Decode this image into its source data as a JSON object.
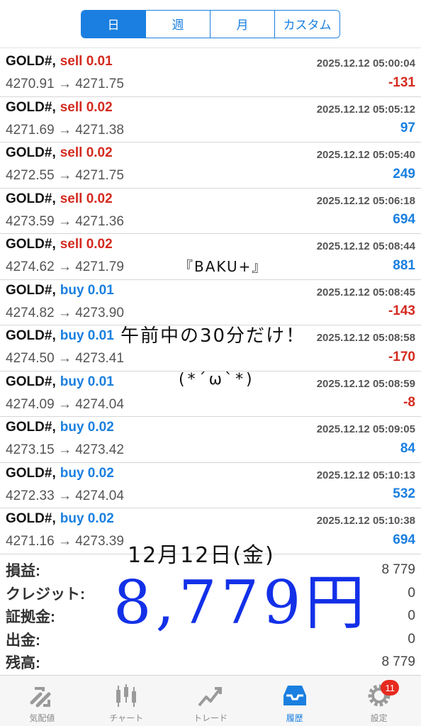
{
  "segments": [
    "日",
    "週",
    "月",
    "カスタム"
  ],
  "trades": [
    {
      "symbol": "GOLD#,",
      "side": "sell",
      "volume": "sell 0.01",
      "time": "2025.12.12 05:00:04",
      "prices": "4270.91 → 4271.75",
      "profit": "-131"
    },
    {
      "symbol": "GOLD#,",
      "side": "sell",
      "volume": "sell 0.02",
      "time": "2025.12.12 05:05:12",
      "prices": "4271.69 → 4271.38",
      "profit": "97"
    },
    {
      "symbol": "GOLD#,",
      "side": "sell",
      "volume": "sell 0.02",
      "time": "2025.12.12 05:05:40",
      "prices": "4272.55 → 4271.75",
      "profit": "249"
    },
    {
      "symbol": "GOLD#,",
      "side": "sell",
      "volume": "sell 0.02",
      "time": "2025.12.12 05:06:18",
      "prices": "4273.59 → 4271.36",
      "profit": "694"
    },
    {
      "symbol": "GOLD#,",
      "side": "sell",
      "volume": "sell 0.02",
      "time": "2025.12.12 05:08:44",
      "prices": "4274.62 → 4271.79",
      "profit": "881"
    },
    {
      "symbol": "GOLD#,",
      "side": "buy",
      "volume": "buy 0.01",
      "time": "2025.12.12 05:08:45",
      "prices": "4274.82 → 4273.90",
      "profit": "-143"
    },
    {
      "symbol": "GOLD#,",
      "side": "buy",
      "volume": "buy 0.01",
      "time": "2025.12.12 05:08:58",
      "prices": "4274.50 → 4273.41",
      "profit": "-170"
    },
    {
      "symbol": "GOLD#,",
      "side": "buy",
      "volume": "buy 0.01",
      "time": "2025.12.12 05:08:59",
      "prices": "4274.09 → 4274.04",
      "profit": "-8"
    },
    {
      "symbol": "GOLD#,",
      "side": "buy",
      "volume": "buy 0.02",
      "time": "2025.12.12 05:09:05",
      "prices": "4273.15 → 4273.42",
      "profit": "84"
    },
    {
      "symbol": "GOLD#,",
      "side": "buy",
      "volume": "buy 0.02",
      "time": "2025.12.12 05:10:13",
      "prices": "4272.33 → 4274.04",
      "profit": "532"
    },
    {
      "symbol": "GOLD#,",
      "side": "buy",
      "volume": "buy 0.02",
      "time": "2025.12.12 05:10:38",
      "prices": "4271.16 → 4273.39",
      "profit": "694"
    }
  ],
  "summary": [
    {
      "label": "損益:",
      "value": "8 779"
    },
    {
      "label": "クレジット:",
      "value": "0"
    },
    {
      "label": "証拠金:",
      "value": "0"
    },
    {
      "label": "出金:",
      "value": "0"
    },
    {
      "label": "残高:",
      "value": "8 779"
    }
  ],
  "tabs": [
    {
      "label": "気配値",
      "icon": "quotes-icon"
    },
    {
      "label": "チャート",
      "icon": "chart-icon"
    },
    {
      "label": "トレード",
      "icon": "trade-icon"
    },
    {
      "label": "履歴",
      "icon": "history-icon"
    },
    {
      "label": "設定",
      "icon": "settings-icon"
    }
  ],
  "settings_badge": "11",
  "annotations": {
    "tag": "『BAKU+』",
    "note": "午前中の30分だけ！",
    "face": "(*´ω`*)",
    "date": "12月12日(金)",
    "total": "8,779円"
  },
  "colors": {
    "accent": "#1a7fe0",
    "loss": "#d42a1f",
    "handwriting_blue": "#1330e8"
  }
}
